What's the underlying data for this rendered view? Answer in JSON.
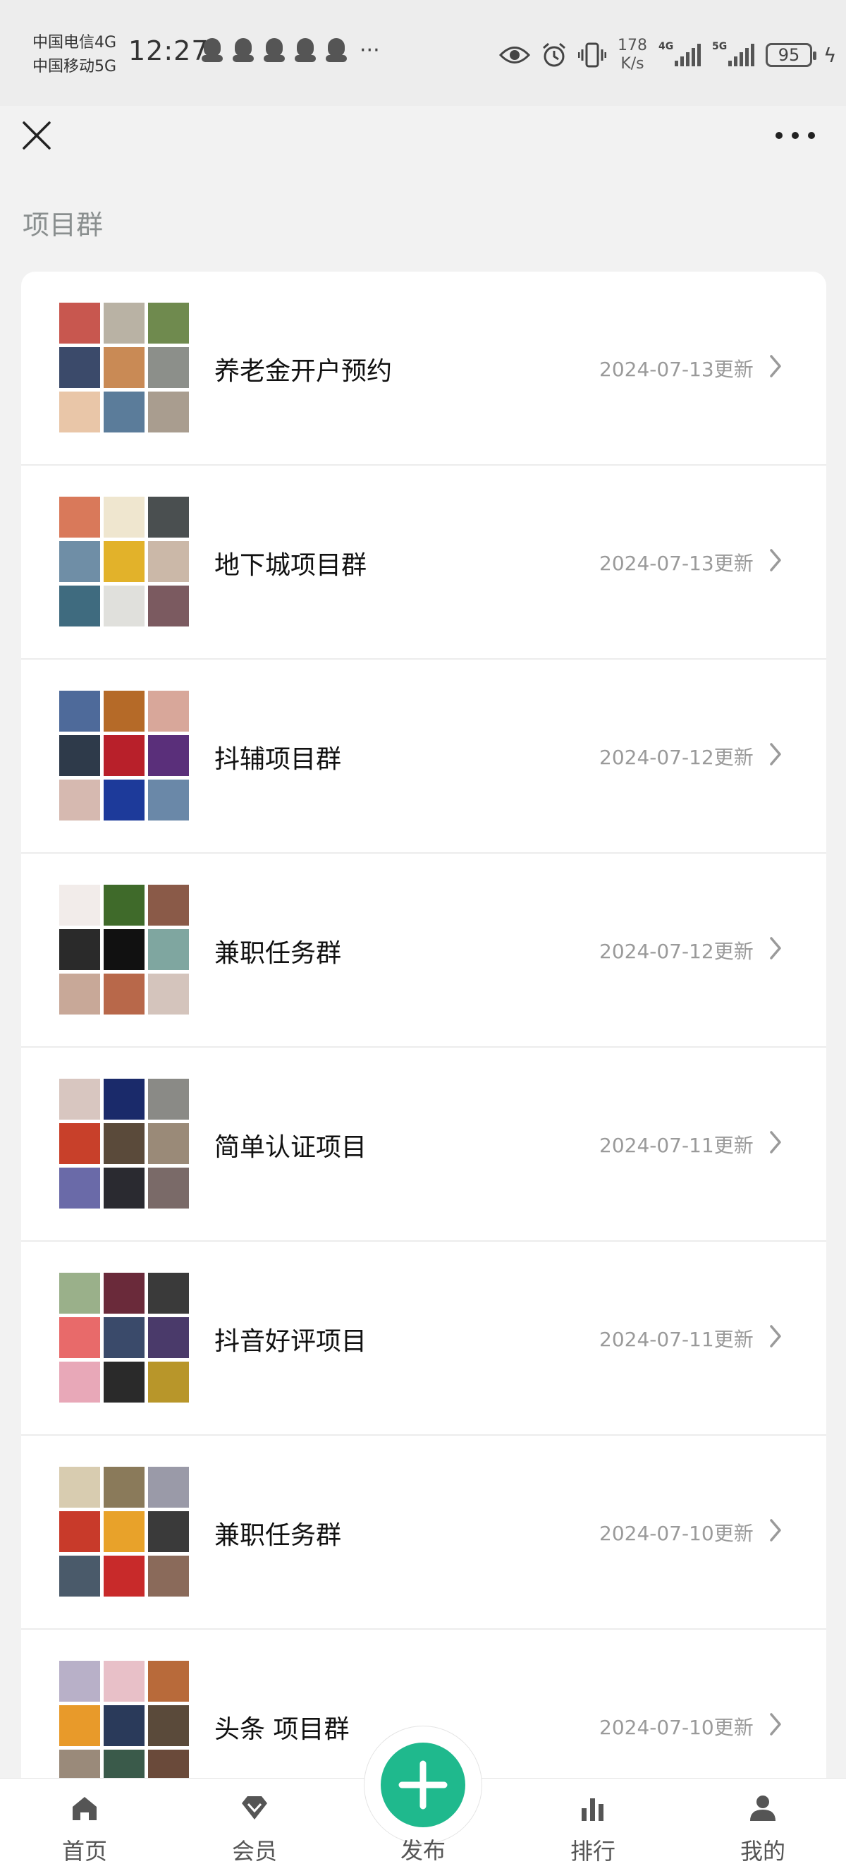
{
  "status_bar": {
    "carrier_1": "中国电信4G",
    "carrier_2": "中国移动5G",
    "time": "12:27",
    "more_notifications": "···",
    "net_speed_value": "178",
    "net_speed_unit": "K/s",
    "signal_1_label": "4G",
    "signal_2_label": "5G",
    "battery": "95",
    "icons": [
      "qq-icon",
      "qq-icon",
      "qq-icon",
      "qq-icon",
      "qq-icon",
      "eye-icon",
      "alarm-icon",
      "vibrate-icon",
      "signal-icon",
      "signal-icon",
      "battery-icon",
      "charging-icon"
    ]
  },
  "nav": {
    "close_icon": "close-icon",
    "more_icon": "more-icon"
  },
  "section_title": "项目群",
  "groups": [
    {
      "name": "养老金开户预约",
      "date": "2024-07-13更新",
      "avatars": [
        "#c8574f",
        "#b9b2a4",
        "#6f8a4e",
        "#3b4a6a",
        "#c98a55",
        "#8c8f8a",
        "#e9c6a8",
        "#5b7c9a",
        "#a99d8f"
      ]
    },
    {
      "name": "地下城项目群",
      "date": "2024-07-13更新",
      "avatars": [
        "#d9795a",
        "#efe6cf",
        "#4a4f50",
        "#6f8ea6",
        "#e2b22a",
        "#cbb8a8",
        "#3f6b7f",
        "#e0e0dc",
        "#7b5a60"
      ]
    },
    {
      "name": "抖辅项目群",
      "date": "2024-07-12更新",
      "avatars": [
        "#4e6a9a",
        "#b56a28",
        "#d8a79a",
        "#2e3a4a",
        "#b8202a",
        "#5a2f7a",
        "#d6b9b0",
        "#1d3a9a",
        "#6a88a8"
      ]
    },
    {
      "name": "兼职任务群",
      "date": "2024-07-12更新",
      "avatars": [
        "#f2ecea",
        "#3f6a2a",
        "#8a5a48",
        "#2a2a2a",
        "#111111",
        "#7fa6a0",
        "#c8a898",
        "#b8684a",
        "#d4c4bc"
      ]
    },
    {
      "name": "简单认证项目",
      "date": "2024-07-11更新",
      "avatars": [
        "#d8c6c0",
        "#1a2a6a",
        "#8a8a86",
        "#c8402a",
        "#5a4a3a",
        "#9a8a78",
        "#6a6aa8",
        "#2a2a30",
        "#7a6a68"
      ]
    },
    {
      "name": "抖音好评项目",
      "date": "2024-07-11更新",
      "avatars": [
        "#9ab08a",
        "#6a2a3a",
        "#3a3a3a",
        "#e86a6a",
        "#3a4a6a",
        "#4a3a6a",
        "#e8a8b8",
        "#2a2a2a",
        "#b8962a"
      ]
    },
    {
      "name": "兼职任务群",
      "date": "2024-07-10更新",
      "avatars": [
        "#d8ccb0",
        "#8a7a5a",
        "#9a9aa8",
        "#c83a2a",
        "#e8a22a",
        "#3a3a3a",
        "#4a5a6a",
        "#c82a2a",
        "#8a6a5a"
      ]
    },
    {
      "name": "头条 项目群",
      "date": "2024-07-10更新",
      "avatars": [
        "#b8b0c8",
        "#e8c0c8",
        "#b86a3a",
        "#e89a2a",
        "#2a3a5a",
        "#5a4a3a",
        "#9a8a7a",
        "#3a5a4a",
        "#6a4a3a"
      ]
    }
  ],
  "tabs": [
    {
      "label": "首页",
      "icon": "home-icon"
    },
    {
      "label": "会员",
      "icon": "diamond-icon"
    },
    {
      "label": "发布",
      "icon": "plus-icon"
    },
    {
      "label": "排行",
      "icon": "bar-chart-icon"
    },
    {
      "label": "我的",
      "icon": "user-icon"
    }
  ],
  "colors": {
    "accent": "#1fb98d",
    "background": "#f2f2f2",
    "date_text": "#9a9a9a",
    "section_title": "#8a8f8f"
  }
}
